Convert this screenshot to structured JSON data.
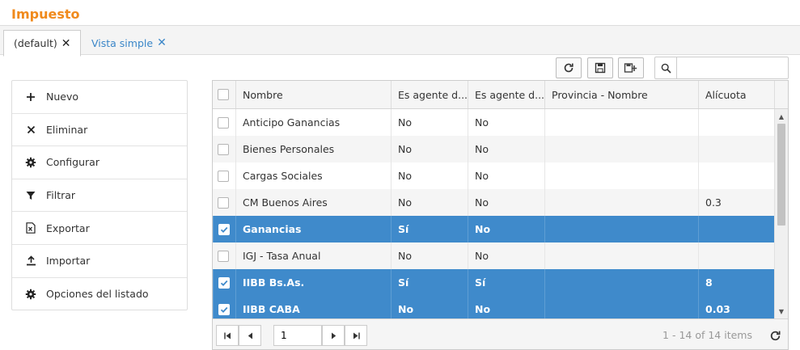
{
  "page_title": "Impuesto",
  "tabs": [
    {
      "label": "(default)",
      "close_icon": "close-icon"
    },
    {
      "label": "Vista simple",
      "close_icon": "close-icon"
    }
  ],
  "toolbar": {
    "refresh_icon": "refresh-icon",
    "save_icon": "save-icon",
    "save_as_icon": "save-as-icon",
    "search": {
      "icon": "search-icon",
      "value": "",
      "placeholder": ""
    }
  },
  "menu": {
    "items": [
      {
        "label": "Nuevo",
        "icon": "plus-icon"
      },
      {
        "label": "Eliminar",
        "icon": "close-icon"
      },
      {
        "label": "Configurar",
        "icon": "gear-icon"
      },
      {
        "label": "Filtrar",
        "icon": "filter-icon"
      },
      {
        "label": "Exportar",
        "icon": "excel-icon"
      },
      {
        "label": "Importar",
        "icon": "upload-icon"
      },
      {
        "label": "Opciones del listado",
        "icon": "gear-icon"
      }
    ]
  },
  "grid": {
    "columns": [
      "",
      "Nombre",
      "Es agente d...",
      "Es agente d...",
      "Provincia - Nombre",
      "Alícuota"
    ],
    "rows": [
      {
        "selected": false,
        "nombre": "Anticipo Ganancias",
        "agente1": "No",
        "agente2": "No",
        "provincia": "",
        "alicuota": ""
      },
      {
        "selected": false,
        "nombre": "Bienes Personales",
        "agente1": "No",
        "agente2": "No",
        "provincia": "",
        "alicuota": ""
      },
      {
        "selected": false,
        "nombre": "Cargas Sociales",
        "agente1": "No",
        "agente2": "No",
        "provincia": "",
        "alicuota": ""
      },
      {
        "selected": false,
        "nombre": "CM Buenos Aires",
        "agente1": "No",
        "agente2": "No",
        "provincia": "",
        "alicuota": "0.3"
      },
      {
        "selected": true,
        "nombre": "Ganancias",
        "agente1": "Sí",
        "agente2": "No",
        "provincia": "",
        "alicuota": ""
      },
      {
        "selected": false,
        "nombre": "IGJ - Tasa Anual",
        "agente1": "No",
        "agente2": "No",
        "provincia": "",
        "alicuota": ""
      },
      {
        "selected": true,
        "nombre": "IIBB Bs.As.",
        "agente1": "Sí",
        "agente2": "Sí",
        "provincia": "",
        "alicuota": "8"
      },
      {
        "selected": true,
        "nombre": "IIBB CABA",
        "agente1": "No",
        "agente2": "No",
        "provincia": "",
        "alicuota": "0.03"
      }
    ]
  },
  "pager": {
    "page_value": "1",
    "info": "1 - 14 of 14 items"
  },
  "colors": {
    "accent_title": "#f08a1c",
    "link": "#3a86c8",
    "selected_row": "#3f8acb"
  }
}
